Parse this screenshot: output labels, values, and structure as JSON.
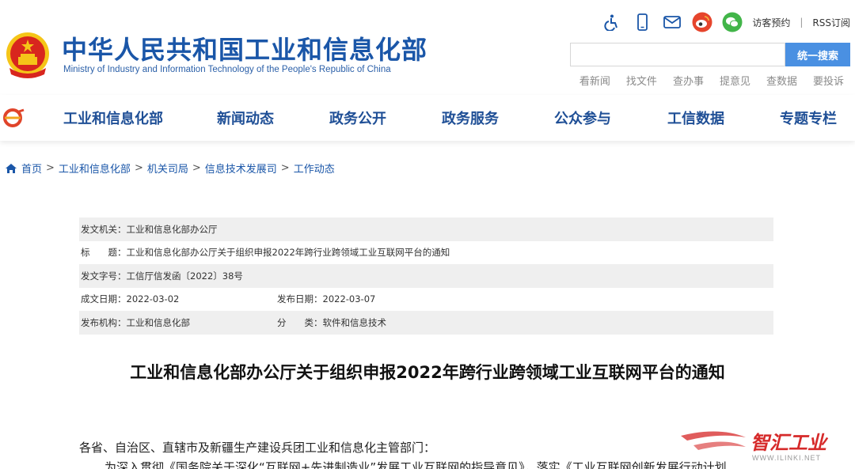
{
  "header": {
    "title": "中华人民共和国工业和信息化部",
    "subtitle": "Ministry of Industry and Information Technology of the People's Republic of China"
  },
  "toolbar": {
    "icons": [
      "accessibility-icon",
      "mobile-icon",
      "mail-icon",
      "weibo-icon",
      "wechat-icon"
    ],
    "visitor_link": "访客预约",
    "separator": "|",
    "rss_link": "RSS订阅"
  },
  "search": {
    "placeholder": "",
    "button_label": "统一搜索"
  },
  "quick_links": [
    "看新闻",
    "找文件",
    "查办事",
    "提意见",
    "查数据",
    "要投诉"
  ],
  "nav": {
    "items": [
      "工业和信息化部",
      "新闻动态",
      "政务公开",
      "政务服务",
      "公众参与",
      "工信数据",
      "专题专栏"
    ]
  },
  "breadcrumb": {
    "items": [
      "首页",
      "工业和信息化部",
      "机关司局",
      "信息技术发展司",
      "工作动态"
    ],
    "separator": ">"
  },
  "meta": {
    "issuer": "发文机关：工业和信息化部办公厅",
    "title": "标　　题：工业和信息化部办公厅关于组织申报2022年跨行业跨领域工业互联网平台的通知",
    "doc_number": "发文字号：工信厅信发函〔2022〕38号",
    "written_date": "成文日期：2022-03-02",
    "publish_date": "发布日期：2022-03-07",
    "publisher": "发布机构：工业和信息化部",
    "category": "分　　类：软件和信息技术"
  },
  "document": {
    "title": "工业和信息化部办公厅关于组织申报2022年跨行业跨领域工业互联网平台的通知",
    "salutation": "各省、自治区、直辖市及新疆生产建设兵团工业和信息化主管部门：",
    "first_line": "为深入贯彻《国务院关于深化“互联网+先进制造业”发展工业互联网的指导意见》，落实《工业互联网创新发展行动计划"
  },
  "watermark": {
    "text": "智汇工业",
    "url": "WWW.ILINKI.NET"
  },
  "colors": {
    "brand_blue": "#1a56a8",
    "search_button": "#4a90e2",
    "emblem_red": "#d8261e",
    "emblem_gold": "#f5c518"
  }
}
